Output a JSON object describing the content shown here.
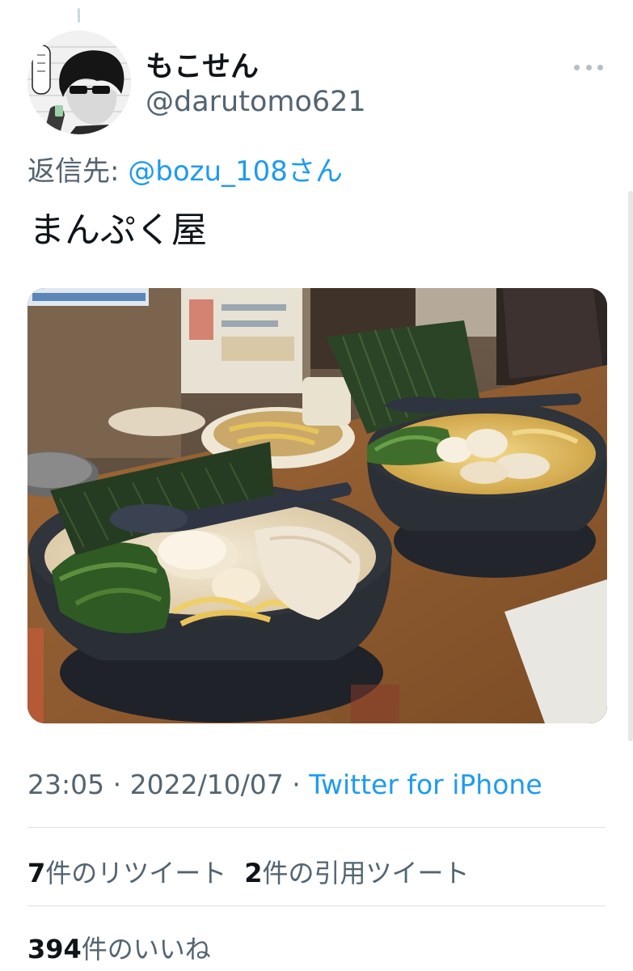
{
  "tweet": {
    "author": {
      "display_name": "もこせん",
      "username": "@darutomo621",
      "avatar_icon": "user-avatar"
    },
    "more_icon": "more-dots-icon",
    "reply": {
      "prefix": "返信先: ",
      "mention": "@bozu_108さん"
    },
    "text": "まんぷく屋",
    "media": {
      "type": "photo",
      "content": "two bowls of ramen with nori, egg and chashu"
    },
    "meta": {
      "time": "23:05",
      "separator": " · ",
      "date": "2022/10/07",
      "source": "Twitter for iPhone"
    },
    "stats": {
      "retweets": {
        "count": "7",
        "label": "件のリツイート"
      },
      "quotes": {
        "count": "2",
        "label": "件の引用ツイート"
      },
      "likes": {
        "count": "394",
        "label": "件のいいね"
      }
    }
  },
  "colors": {
    "link": "#1d9bf0",
    "secondary_text": "#536471",
    "primary_text": "#0f1419",
    "divider": "#dce2e6"
  }
}
